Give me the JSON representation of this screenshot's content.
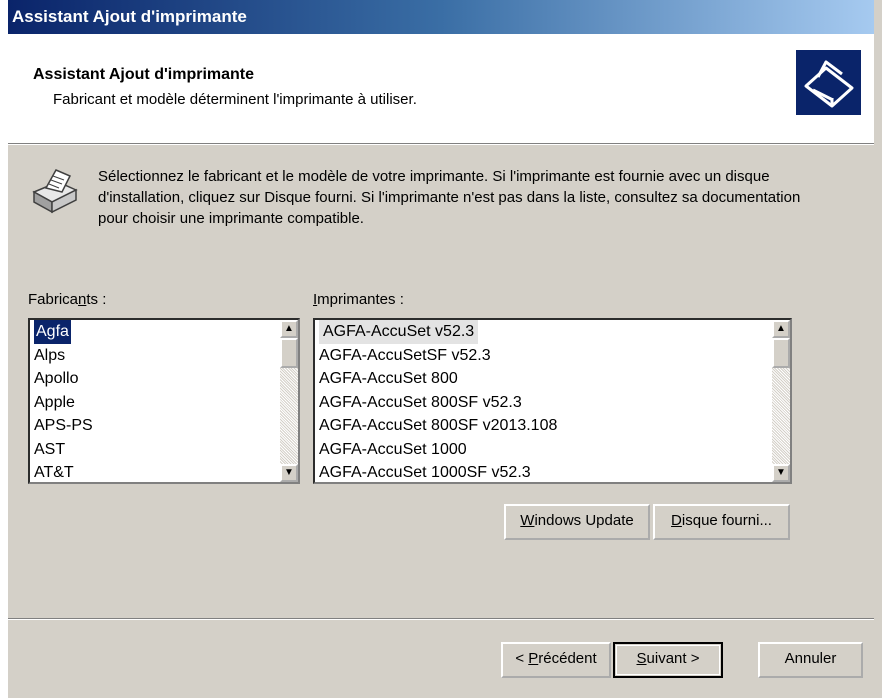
{
  "window": {
    "title": "Assistant Ajout d'imprimante"
  },
  "header": {
    "title": "Assistant Ajout d'imprimante",
    "subtitle": "Fabricant et modèle déterminent l'imprimante à utiliser."
  },
  "info": {
    "text": "Sélectionnez le fabricant et le modèle de votre imprimante. Si l'imprimante est fournie avec un disque d'installation, cliquez sur Disque fourni. Si l'imprimante n'est pas dans la liste, consultez sa documentation pour choisir une imprimante compatible."
  },
  "manufacturers": {
    "label_pre": "Fabrica",
    "label_u": "n",
    "label_post": "ts :",
    "selected": "Agfa",
    "items": [
      "Agfa",
      "Alps",
      "Apollo",
      "Apple",
      "APS-PS",
      "AST",
      "AT&T"
    ]
  },
  "printers": {
    "label_u": "I",
    "label_post": "mprimantes :",
    "selected": "AGFA-AccuSet v52.3",
    "items": [
      "AGFA-AccuSet v52.3",
      "AGFA-AccuSetSF v52.3",
      "AGFA-AccuSet 800",
      "AGFA-AccuSet 800SF v52.3",
      "AGFA-AccuSet 800SF v2013.108",
      "AGFA-AccuSet 1000",
      "AGFA-AccuSet 1000SF v52.3"
    ]
  },
  "buttons": {
    "windows_update": {
      "u": "W",
      "rest": "indows Update"
    },
    "have_disk": {
      "u": "D",
      "rest": "isque fourni..."
    },
    "back": {
      "pre": "< ",
      "u": "P",
      "rest": "récédent"
    },
    "next": {
      "u": "S",
      "rest": "uivant >"
    },
    "cancel": "Annuler"
  }
}
